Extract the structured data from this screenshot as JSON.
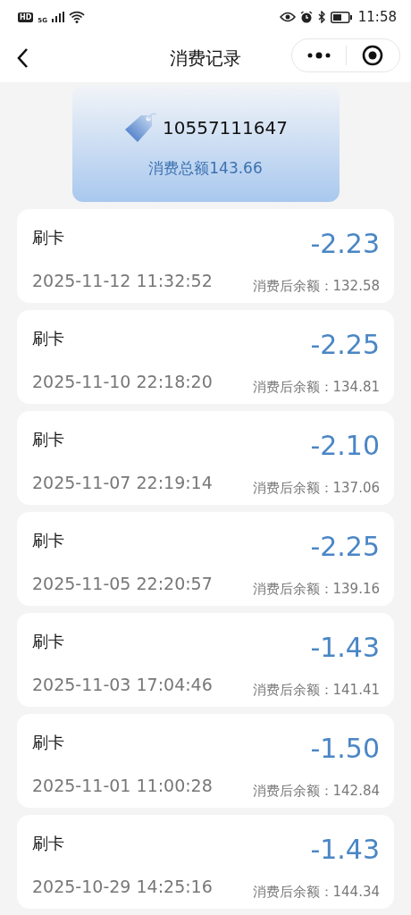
{
  "status_bar": {
    "hd": "HD",
    "network": "5G",
    "time": "11:58"
  },
  "nav": {
    "title": "消费记录"
  },
  "summary": {
    "card_number": "10557111647",
    "total": "消费总额143.66"
  },
  "records": [
    {
      "type": "刷卡",
      "time": "2025-11-12 11:32:52",
      "amount": "-2.23",
      "balance": "消费后余额：132.58"
    },
    {
      "type": "刷卡",
      "time": "2025-11-10 22:18:20",
      "amount": "-2.25",
      "balance": "消费后余额：134.81"
    },
    {
      "type": "刷卡",
      "time": "2025-11-07 22:19:14",
      "amount": "-2.10",
      "balance": "消费后余额：137.06"
    },
    {
      "type": "刷卡",
      "time": "2025-11-05 22:20:57",
      "amount": "-2.25",
      "balance": "消费后余额：139.16"
    },
    {
      "type": "刷卡",
      "time": "2025-11-03 17:04:46",
      "amount": "-1.43",
      "balance": "消费后余额：141.41"
    },
    {
      "type": "刷卡",
      "time": "2025-11-01 11:00:28",
      "amount": "-1.50",
      "balance": "消费后余额：142.84"
    },
    {
      "type": "刷卡",
      "time": "2025-10-29 14:25:16",
      "amount": "-1.43",
      "balance": "消费后余额：144.34"
    }
  ]
}
